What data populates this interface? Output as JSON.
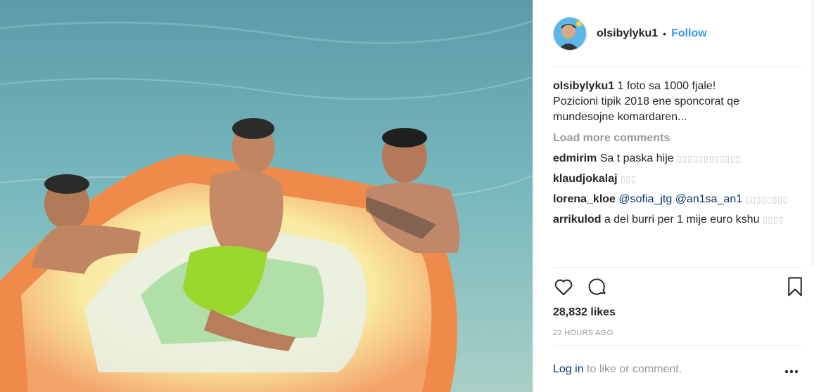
{
  "post": {
    "username": "olsibylyku1",
    "dot": "•",
    "follow_label": "Follow",
    "caption_user": "olsibylyku1",
    "caption_text": "1 foto sa 1000 fjale!\nPozicioni tipik 2018 ene sponcorat qe mundesojne komardaren...",
    "load_more": "Load more comments",
    "comments": [
      {
        "user": "edmirim",
        "text": "Sa t paska hije",
        "emoji": "▯▯▯▯▯▯▯▯▯▯▯▯"
      },
      {
        "user": "klaudjokalaj",
        "text": "",
        "emoji": "▯▯▯"
      },
      {
        "user": "lorena_kloe",
        "mention1": "@sofia_jtg",
        "mention2": "@an1sa_an1",
        "emoji": "▯▯▯▯▯▯▯▯"
      },
      {
        "user": "arrikulod",
        "text": "a del burri per 1 mije euro kshu",
        "emoji": "▯▯▯▯"
      }
    ],
    "likes": "28,832 likes",
    "time": "22 HOURS AGO",
    "login_link": "Log in",
    "login_rest": " to like or comment."
  },
  "icons": {
    "like": "heart-icon",
    "comment": "comment-icon",
    "save": "bookmark-icon",
    "more": "more-options-icon"
  }
}
